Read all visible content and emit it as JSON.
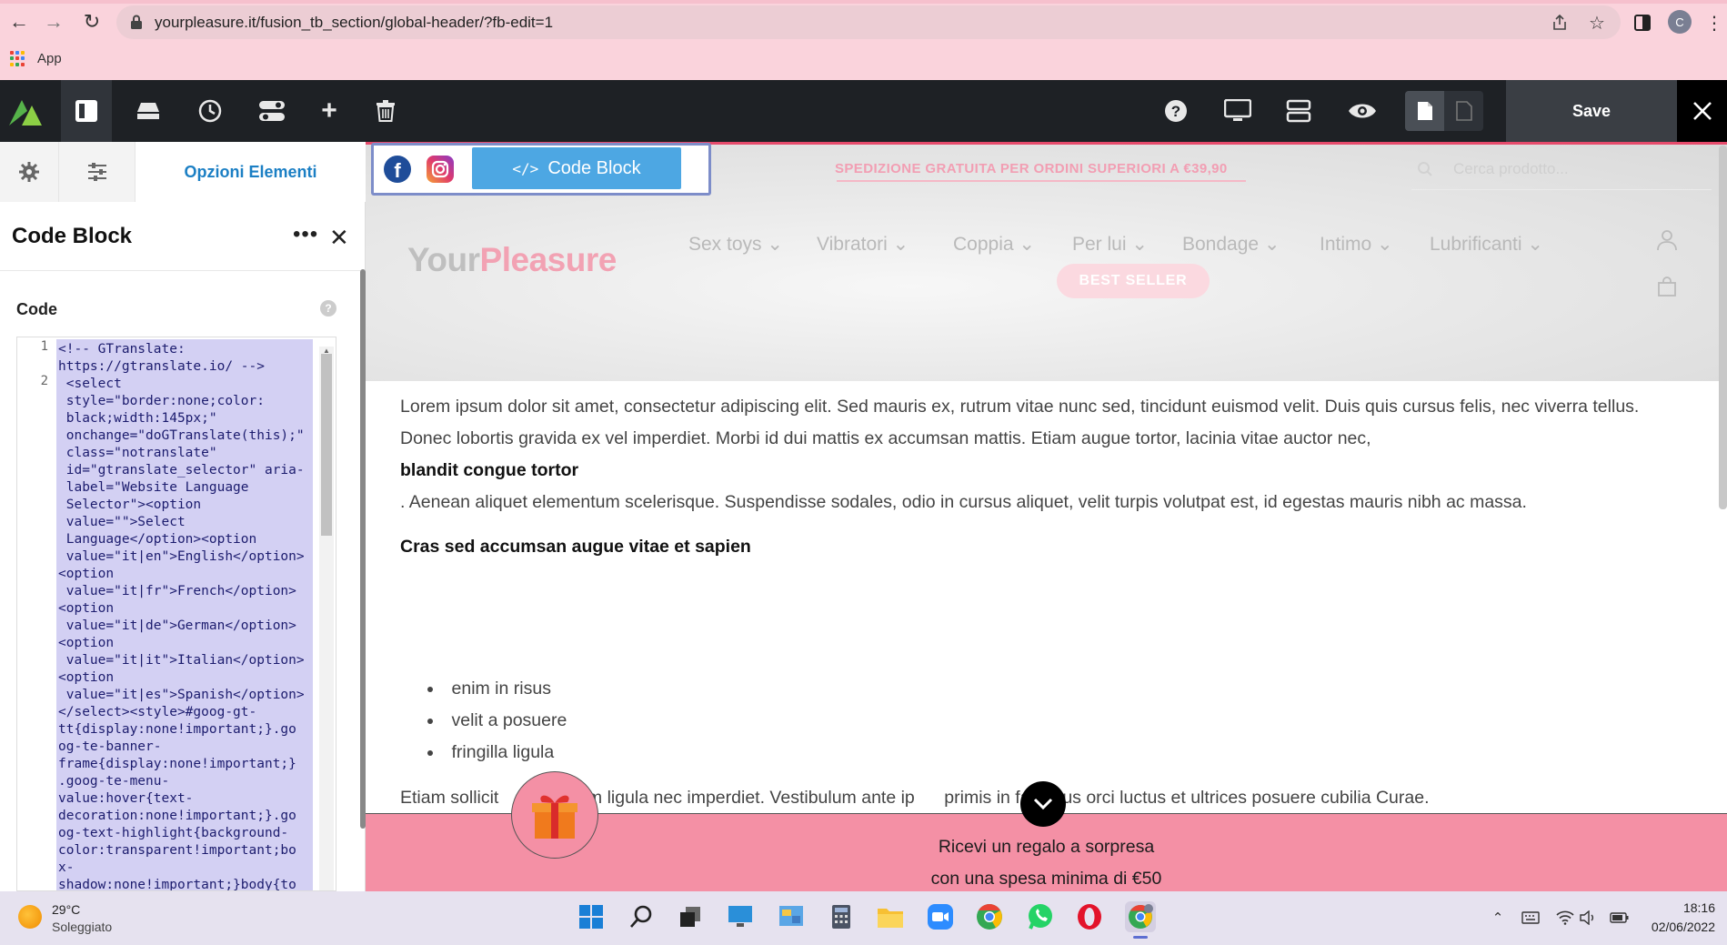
{
  "browser": {
    "url": "yourpleasure.it/fusion_tb_section/global-header/?fb-edit=1",
    "bookmarks_app_label": "App",
    "profile_initial": "C"
  },
  "builder": {
    "save_label": "Save"
  },
  "sidebar": {
    "elements_tab_label": "Opzioni Elementi",
    "panel_title": "Code Block",
    "panel_more": "•••",
    "code_label": "Code",
    "code_lines": [
      "1",
      "2"
    ],
    "code_text": "<!-- GTranslate:\nhttps://gtranslate.io/ -->\n <select\n style=\"border:none;color:\n black;width:145px;\"\n onchange=\"doGTranslate(this);\"\n class=\"notranslate\"\n id=\"gtranslate_selector\" aria-\n label=\"Website Language\n Selector\"><option\n value=\"\">Select\n Language</option><option\n value=\"it|en\">English</option>\n<option\n value=\"it|fr\">French</option>\n<option\n value=\"it|de\">German</option>\n<option\n value=\"it|it\">Italian</option>\n<option\n value=\"it|es\">Spanish</option>\n</select><style>#goog-gt-\ntt{display:none!important;}.go\nog-te-banner-\nframe{display:none!important;}\n.goog-te-menu-\nvalue:hover{text-\ndecoration:none!important;}.go\nog-text-highlight{background-\ncolor:transparent!important;bo\nx-\nshadow:none!important;}body{to"
  },
  "preview": {
    "code_block_chip": "Code Block",
    "shipping_banner": "SPEDIZIONE GRATUITA PER ORDINI SUPERIORI A €39,90",
    "search_placeholder": "Cerca prodotto...",
    "logo_part1": "Your",
    "logo_part2": "Pleasure",
    "nav": [
      "Sex toys",
      "Vibratori",
      "Coppia",
      "Per lui",
      "Bondage",
      "Intimo",
      "Lubrificanti"
    ],
    "best_seller": "BEST SELLER",
    "para1": "Lorem ipsum dolor sit amet, consectetur adipiscing elit. Sed mauris ex, rutrum vitae nunc sed, tincidunt euismod velit. Duis quis cursus felis, nec viverra tellus. Donec lobortis gravida ex vel imperdiet. Morbi id dui mattis ex accumsan mattis. Etiam augue tortor, lacinia vitae auctor nec,",
    "para1_strong": "blandit congue tortor",
    "para1_tail": ". Aenean aliquet elementum scelerisque. Suspendisse sodales, odio in cursus aliquet, velit turpis volutpat est, id egestas mauris nibh ac massa.",
    "heading2": "Cras sed accumsan augue vitae et sapien",
    "list": [
      "enim in risus",
      "velit a posuere",
      "fringilla ligula"
    ],
    "para_last": "Etiam sollicit          endum ligula nec imperdiet. Vestibulum ante ip      primis in faucibus orci luctus et ultrices posuere cubilia Curae.",
    "gift_line1": "Ricevi un regalo a sorpresa",
    "gift_line2": "con una spesa minima di €50"
  },
  "taskbar": {
    "weather_temp": "29°C",
    "weather_desc": "Soleggiato",
    "time": "18:16",
    "date": "02/06/2022"
  },
  "colors": {
    "accent_pink": "#f490a5",
    "builder_dark": "#1e2125",
    "link_blue": "#1b7fc4",
    "code_bg": "#d3d0f3"
  }
}
